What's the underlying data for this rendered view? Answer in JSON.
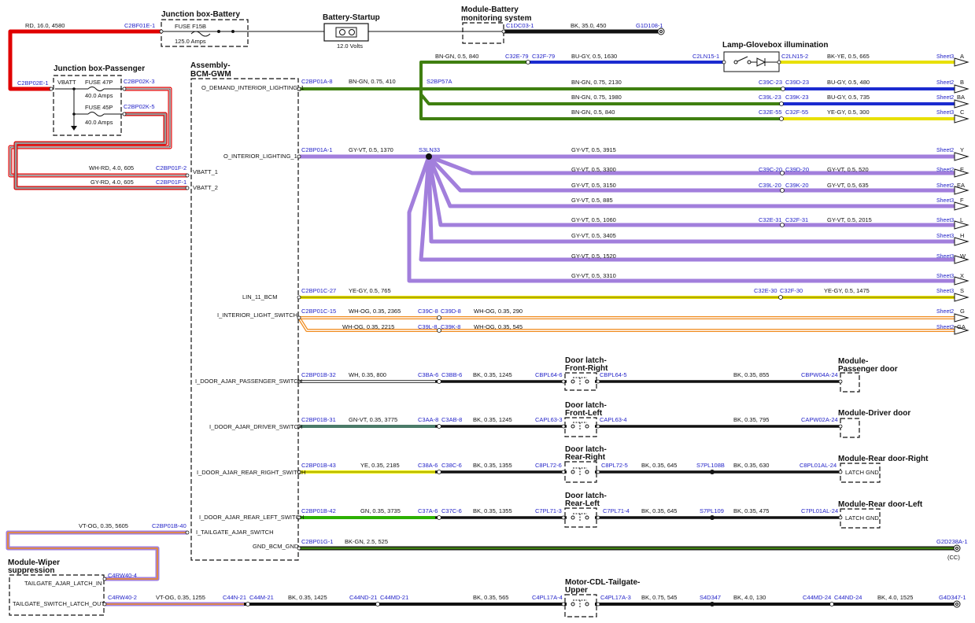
{
  "titles": {
    "jb_battery": "Junction box-Battery",
    "battery": "Battery-Startup",
    "bms_1": "Module-Battery",
    "bms_2": "monitoring system",
    "glovebox": "Lamp-Glovebox illumination",
    "jb_passenger": "Junction box-Passenger",
    "bcm_1": "Assembly-",
    "bcm_2": "BCM-GWM",
    "dl_fr_1": "Door latch-",
    "dl_fr_2": "Front-Right",
    "dl_fl_1": "Door latch-",
    "dl_fl_2": "Front-Left",
    "dl_rr_1": "Door latch-",
    "dl_rr_2": "Rear-Right",
    "dl_rl_1": "Door latch-",
    "dl_rl_2": "Rear-Left",
    "mod_pd_1": "Module-",
    "mod_pd_2": "Passenger door",
    "mod_dd": "Module-Driver door",
    "mod_rdr": "Module-Rear door-Right",
    "mod_rdl": "Module-Rear door-Left",
    "wiper_1": "Module-Wiper",
    "wiper_2": "suppression",
    "cdl_1": "Motor-CDL-Tailgate-",
    "cdl_2": "Upper"
  },
  "components": {
    "fuse_f15b": "FUSE F15B",
    "fuse_f15b_rating": "125.0 Amps",
    "battery_voltage": "12.0 Volts",
    "vbatt": "VBATT",
    "fuse_47p": "FUSE 47P",
    "fuse_47p_rating": "40.0 Amps",
    "fuse_45p": "FUSE 45P",
    "fuse_45p_rating": "40.0 Amps",
    "latch_gnd_r": "LATCH GND",
    "latch_gnd_l": "LATCH GND",
    "cc": "(CC)"
  },
  "bcm_pins": {
    "o_demand": "O_DEMAND_INTERIOR_LIGHTING_1",
    "vbatt_1": "VBATT_1",
    "vbatt_2": "VBATT_2",
    "o_interior": "O_INTERIOR_LIGHTING_1",
    "lin": "LIN_11_BCM",
    "i_interior": "I_INTERIOR_LIGHT_SWITCH",
    "i_pass": "I_DOOR_AJAR_PASSENGER_SWITCH",
    "i_driver": "I_DOOR_AJAR_DRIVER_SWITCH",
    "i_rr": "I_DOOR_AJAR_REAR_RIGHT_SWITCH",
    "i_rl": "I_DOOR_AJAR_REAR_LEFT_SWITCH",
    "i_tailgate": "I_TAILGATE_AJAR_SWITCH",
    "gnd": "GND_BCM_GND",
    "wiper_in": "TAILGATE_AJAR_LATCH_IN",
    "wiper_out": "TAILGATE_SWITCH_LATCH_OUT"
  },
  "connectors": {
    "c2bf01e1": "C2BF01E-1",
    "c1dc03": "C1DC03-1",
    "g1d108": "G1D108-1",
    "c2bp02e1": "C2BP02E-1",
    "c2bp02k3": "C2BP02K-3",
    "c2bp02k5": "C2BP02K-5",
    "c2bp01f2": "C2BP01F-2",
    "c2bp01f1": "C2BP01F-1",
    "c2bp01a8": "C2BP01A-8",
    "s2bp57a": "S2BP57A",
    "c32e79": "C32E-79",
    "c32f79": "C32F-79",
    "c2ln151": "C2LN15-1",
    "c2ln152": "C2LN15-2",
    "c39c23": "C39C-23",
    "c39d23": "C39D-23",
    "c39l23": "C39L-23",
    "c39k23": "C39K-23",
    "c32e55": "C32E-55",
    "c32f55": "C32F-55",
    "c2bp01a1": "C2BP01A-1",
    "s3ln33": "S3LN33",
    "c39c20": "C39C-20",
    "c39d20": "C39D-20",
    "c39l20": "C39L-20",
    "c39k20": "C39K-20",
    "c32e31": "C32E-31",
    "c32f31": "C32F-31",
    "c2bp01c27": "C2BP01C-27",
    "c32e30": "C32E-30",
    "c32f30": "C32F-30",
    "c2bp01c15": "C2BP01C-15",
    "c39c8": "C39C-8",
    "c39d8": "C39D-8",
    "c39l8": "C39L-8",
    "c39k8": "C39K-8",
    "c2bp01b32": "C2BP01B-32",
    "c3ba6": "C3BA-6",
    "c3bb6": "C3BB-6",
    "cbpl64_6": "CBPL64-6",
    "cbpl64_5": "CBPL64-5",
    "cbpw04a24": "CBPW04A-24",
    "c2bp01b31": "C2BP01B-31",
    "c3aa8": "C3AA-8",
    "c3ab8": "C3AB-8",
    "capl63_3": "CAPL63-3",
    "capl63_4": "CAPL63-4",
    "capw02a24": "CAPW02A-24",
    "c2bp01b43": "C2BP01B-43",
    "c38a6": "C38A-6",
    "c38c6": "C38C-6",
    "c8pl72_6": "C8PL72-6",
    "c8pl72_5": "C8PL72-5",
    "s7pl108b": "S7PL108B",
    "c8pl01al24": "C8PL01AL-24",
    "c2bp01b42": "C2BP01B-42",
    "c37a6": "C37A-6",
    "c37c6": "C37C-6",
    "c7pl71_3": "C7PL71-3",
    "c7pl71_4": "C7PL71-4",
    "s7pl109": "S7PL109",
    "c7pl01al24": "C7PL01AL-24",
    "c2bp01b40": "C2BP01B-40",
    "c2bp01g1": "C2BP01G-1",
    "g2d238a": "G2D238A-1",
    "c4rw40_4": "C4RW40-4",
    "c4rw40_2": "C4RW40-2",
    "c44n21": "C44N-21",
    "c44m21": "C44M-21",
    "c44nd21": "C44ND-21",
    "c44md21": "C44MD-21",
    "c4pl17a4": "C4PL17A-4",
    "c4pl17a3": "C4PL17A-3",
    "s4d347": "S4D347",
    "c44md24": "C44MD-24",
    "c44nd24": "C44ND-24",
    "g4d347": "G4D347-1"
  },
  "wire_labels": {
    "w_rd16": "RD,  16.0,  4580",
    "w_bk35": "BK,  35.0,  450",
    "w_whrd": "WH-RD,  4.0,  605",
    "w_gyrd": "GY-RD,  4.0,  605",
    "w_bngn410": "BN-GN,  0.75,  410",
    "w_bngn840a": "BN-GN,  0.5,  840",
    "w_bugy1630": "BU-GY,  0.5,  1630",
    "w_bkye665": "BK-YE,  0.5,  665",
    "w_bngn2130": "BN-GN,  0.75,  2130",
    "w_bugy480": "BU-GY,  0.5,  480",
    "w_bngn1980": "BN-GN,  0.75,  1980",
    "w_bugy735": "BU-GY,  0.5,  735",
    "w_bngn840b": "BN-GN,  0.5,  840",
    "w_yegy300": "YE-GY,  0.5,  300",
    "w_gyvt1370": "GY-VT,  0.5,  1370",
    "w_gyvt3915": "GY-VT,  0.5,  3915",
    "w_gyvt3300": "GY-VT,  0.5,  3300",
    "w_gyvt520": "GY-VT,  0.5,  520",
    "w_gyvt3150": "GY-VT,  0.5,  3150",
    "w_gyvt635": "GY-VT,  0.5,  635",
    "w_gyvt885": "GY-VT,  0.5,  885",
    "w_gyvt1060": "GY-VT,  0.5,  1060",
    "w_gyvt2015": "GY-VT,  0.5,  2015",
    "w_gyvt3405": "GY-VT,  0.5,  3405",
    "w_gyvt1520": "GY-VT,  0.5,  1520",
    "w_gyvt3310": "GY-VT,  0.5,  3310",
    "w_yegy765": "YE-GY,  0.5,  765",
    "w_yegy1475": "YE-GY,  0.5,  1475",
    "w_whog2365": "WH-OG,  0.35,  2365",
    "w_whog290": "WH-OG,  0.35,  290",
    "w_whog2215": "WH-OG,  0.35,  2215",
    "w_whog545": "WH-OG,  0.35,  545",
    "w_wh800": "WH,  0.35,  800",
    "w_bk1245a": "BK,  0.35,  1245",
    "w_bk855": "BK,  0.35,  855",
    "w_gnvt3775": "GN-VT,  0.35,  3775",
    "w_bk1245b": "BK,  0.35,  1245",
    "w_bk795": "BK,  0.35,  795",
    "w_ye2185": "YE,  0.35,  2185",
    "w_bk1355a": "BK,  0.35,  1355",
    "w_bk645a": "BK,  0.35,  645",
    "w_bk630": "BK,  0.35,  630",
    "w_gn3735": "GN,  0.35,  3735",
    "w_bk1355b": "BK,  0.35,  1355",
    "w_bk645b": "BK,  0.35,  645",
    "w_bk475": "BK,  0.35,  475",
    "w_vtog5605": "VT-OG,  0.35,  5605",
    "w_bkgn525": "BK-GN,  2.5,  525",
    "w_vtog1255": "VT-OG,  0.35,  1255",
    "w_bk1425": "BK,  0.35,  1425",
    "w_bk565": "BK,  0.35,  565",
    "w_bk545": "BK,  0.75,  545",
    "w_bk130": "BK,  4.0,  130",
    "w_bk1525": "BK,  4.0,  1525"
  },
  "sheet_refs": [
    {
      "sheet": "Sheet3",
      "id": "A"
    },
    {
      "sheet": "Sheet2",
      "id": "B"
    },
    {
      "sheet": "Sheet2",
      "id": "BA"
    },
    {
      "sheet": "Sheet3",
      "id": "C"
    },
    {
      "sheet": "Sheet2",
      "id": "Y"
    },
    {
      "sheet": "Sheet2",
      "id": "E"
    },
    {
      "sheet": "Sheet2",
      "id": "EA"
    },
    {
      "sheet": "Sheet3",
      "id": "F"
    },
    {
      "sheet": "Sheet3",
      "id": "L"
    },
    {
      "sheet": "Sheet3",
      "id": "H"
    },
    {
      "sheet": "Sheet3",
      "id": "W"
    },
    {
      "sheet": "Sheet3",
      "id": "X"
    },
    {
      "sheet": "Sheet3",
      "id": "S"
    },
    {
      "sheet": "Sheet2",
      "id": "G"
    },
    {
      "sheet": "Sheet2",
      "id": "GA"
    }
  ],
  "colors": {
    "red": "#e00000",
    "green": "#3f7f10",
    "blue": "#1b2bd0",
    "yellow": "#e8e000",
    "violet": "#a27fdc",
    "orange": "#f08c1e",
    "label": "#2323c8"
  }
}
